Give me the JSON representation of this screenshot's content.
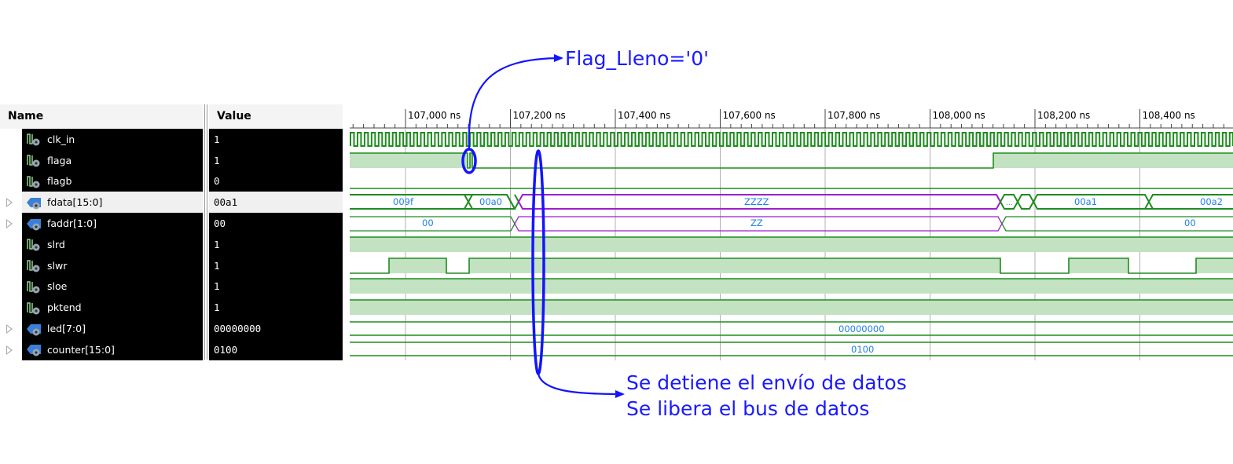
{
  "headers": {
    "name": "Name",
    "value": "Value"
  },
  "signals": [
    {
      "name": "clk_in",
      "value": "1",
      "kind": "bit",
      "expandable": false
    },
    {
      "name": "flaga",
      "value": "1",
      "kind": "bit",
      "expandable": false
    },
    {
      "name": "flagb",
      "value": "0",
      "kind": "bit",
      "expandable": false
    },
    {
      "name": "fdata[15:0]",
      "value": "00a1",
      "kind": "bus",
      "expandable": true,
      "selected": true
    },
    {
      "name": "faddr[1:0]",
      "value": "00",
      "kind": "bus",
      "expandable": true
    },
    {
      "name": "slrd",
      "value": "1",
      "kind": "bit",
      "expandable": false
    },
    {
      "name": "slwr",
      "value": "1",
      "kind": "bit",
      "expandable": false
    },
    {
      "name": "sloe",
      "value": "1",
      "kind": "bit",
      "expandable": false
    },
    {
      "name": "pktend",
      "value": "1",
      "kind": "bit",
      "expandable": false
    },
    {
      "name": "led[7:0]",
      "value": "00000000",
      "kind": "bus",
      "expandable": true
    },
    {
      "name": "counter[15:0]",
      "value": "0100",
      "kind": "bus",
      "expandable": true
    }
  ],
  "timeline": {
    "unit": "ns",
    "major_ticks": [
      "107,000 ns",
      "107,200 ns",
      "107,400 ns",
      "107,600 ns",
      "107,800 ns",
      "108,000 ns",
      "108,200 ns",
      "108,400 ns"
    ]
  },
  "bus_labels": {
    "fdata": [
      "009f",
      "00a0",
      "ZZZZ",
      "...",
      "00a1",
      "00a2"
    ],
    "faddr": [
      "00",
      "ZZ",
      "00"
    ],
    "led": "00000000",
    "counter": "0100"
  },
  "annotations": {
    "flag": "Flag_Lleno='0'",
    "stop_line1": "Se detiene el envío de datos",
    "stop_line2": "Se libera el bus de datos"
  },
  "colors": {
    "wave_green": "#1e8c1e",
    "wave_fill": "#c2e2c2",
    "bus_purple": "#9a1fd0",
    "bus_label": "#1e7fe8",
    "annotation_blue": "#1414ff",
    "grid": "#b0b0b0"
  }
}
